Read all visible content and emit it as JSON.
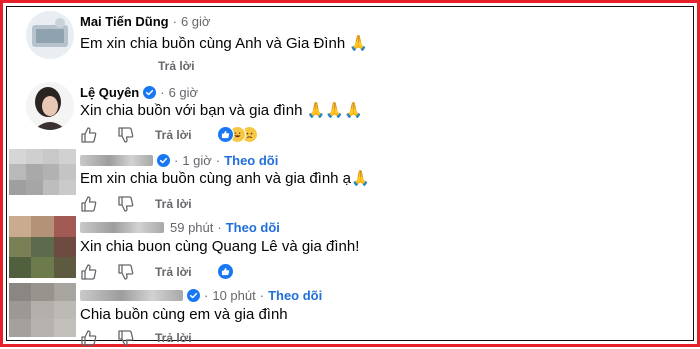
{
  "colors": {
    "frame_border": "#e8202a",
    "link_blue": "#216fdb",
    "secondary_text": "#65676b",
    "like_blue": "#1877f2",
    "verified_blue": "#1877f2"
  },
  "comments": [
    {
      "author": "Mai Tiến Dũng",
      "time": "6 giờ",
      "text": "Em xin chia buồn cùng Anh và Gia Đình",
      "emoji": "🙏",
      "reply_label": "Trả lời"
    },
    {
      "author": "Lệ Quyên",
      "verified": true,
      "time": "6 giờ",
      "text": "Xin chia buồn với bạn và gia đình",
      "emoji": "🙏🙏🙏",
      "reply_label": "Trả lời",
      "reactions": [
        "like-icon",
        "haha-icon",
        "sad-icon"
      ]
    },
    {
      "author_blurred": true,
      "verified": true,
      "time": "1 giờ",
      "follow_label": "Theo dõi",
      "text": "Em xin chia buồn cùng anh và gia đình ạ",
      "emoji": "🙏",
      "reply_label": "Trả lời"
    },
    {
      "author_blurred": true,
      "time": "59 phút",
      "follow_label": "Theo dõi",
      "text": "Xin chia buon cùng Quang Lê và gia đình!",
      "reply_label": "Trả lời",
      "reactions": [
        "like-icon"
      ]
    },
    {
      "author_blurred": true,
      "verified": true,
      "time": "10 phút",
      "follow_label": "Theo dõi",
      "text": "Chia buồn cùng em và gia đình",
      "reply_label": "Trả lời"
    }
  ]
}
